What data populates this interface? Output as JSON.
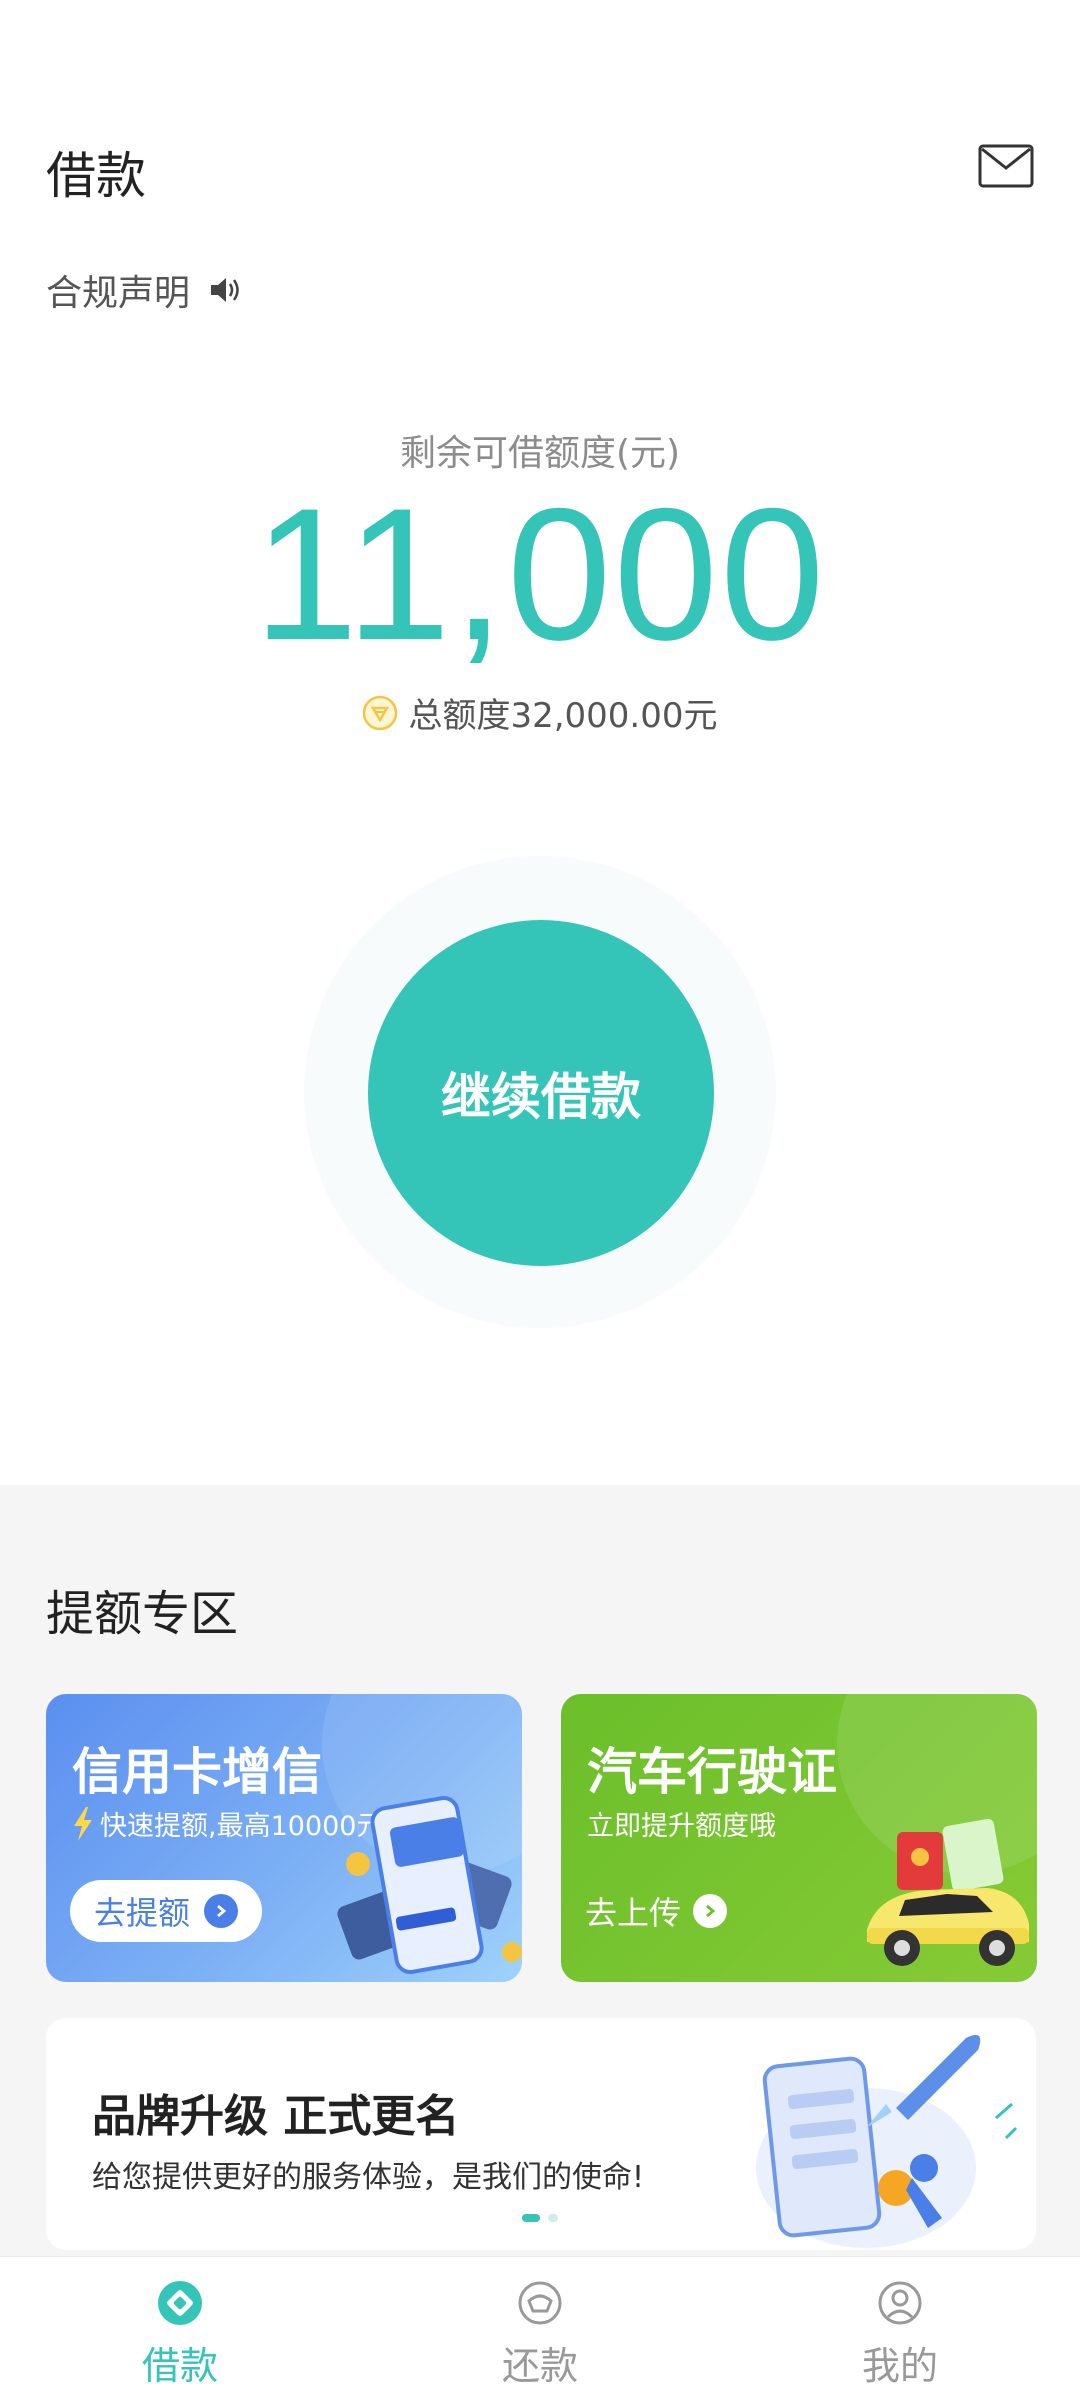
{
  "header": {
    "title": "借款",
    "mail_icon": "mail-icon"
  },
  "notice": {
    "label": "合规声明",
    "icon": "speaker-icon"
  },
  "credit": {
    "label": "剩余可借额度(元)",
    "amount": "11,000",
    "total": "总额度32,000.00元"
  },
  "main_button": {
    "label": "继续借款"
  },
  "boost": {
    "section_title": "提额专区",
    "cards": [
      {
        "title": "信用卡增信",
        "subtitle": "快速提额,最高10000元",
        "action": "去提额"
      },
      {
        "title": "汽车行驶证",
        "subtitle": "立即提升额度哦",
        "action": "去上传"
      }
    ]
  },
  "banner": {
    "title": "品牌升级  正式更名",
    "subtitle": "给您提供更好的服务体验，是我们的使命!"
  },
  "tabbar": {
    "items": [
      {
        "label": "借款",
        "icon": "borrow-icon",
        "active": true
      },
      {
        "label": "还款",
        "icon": "repay-icon",
        "active": false
      },
      {
        "label": "我的",
        "icon": "profile-icon",
        "active": false
      }
    ]
  },
  "colors": {
    "accent": "#35c4b8",
    "card_blue": "#5b8ff0",
    "card_green": "#6bbf2a",
    "gold": "#f5c542"
  }
}
